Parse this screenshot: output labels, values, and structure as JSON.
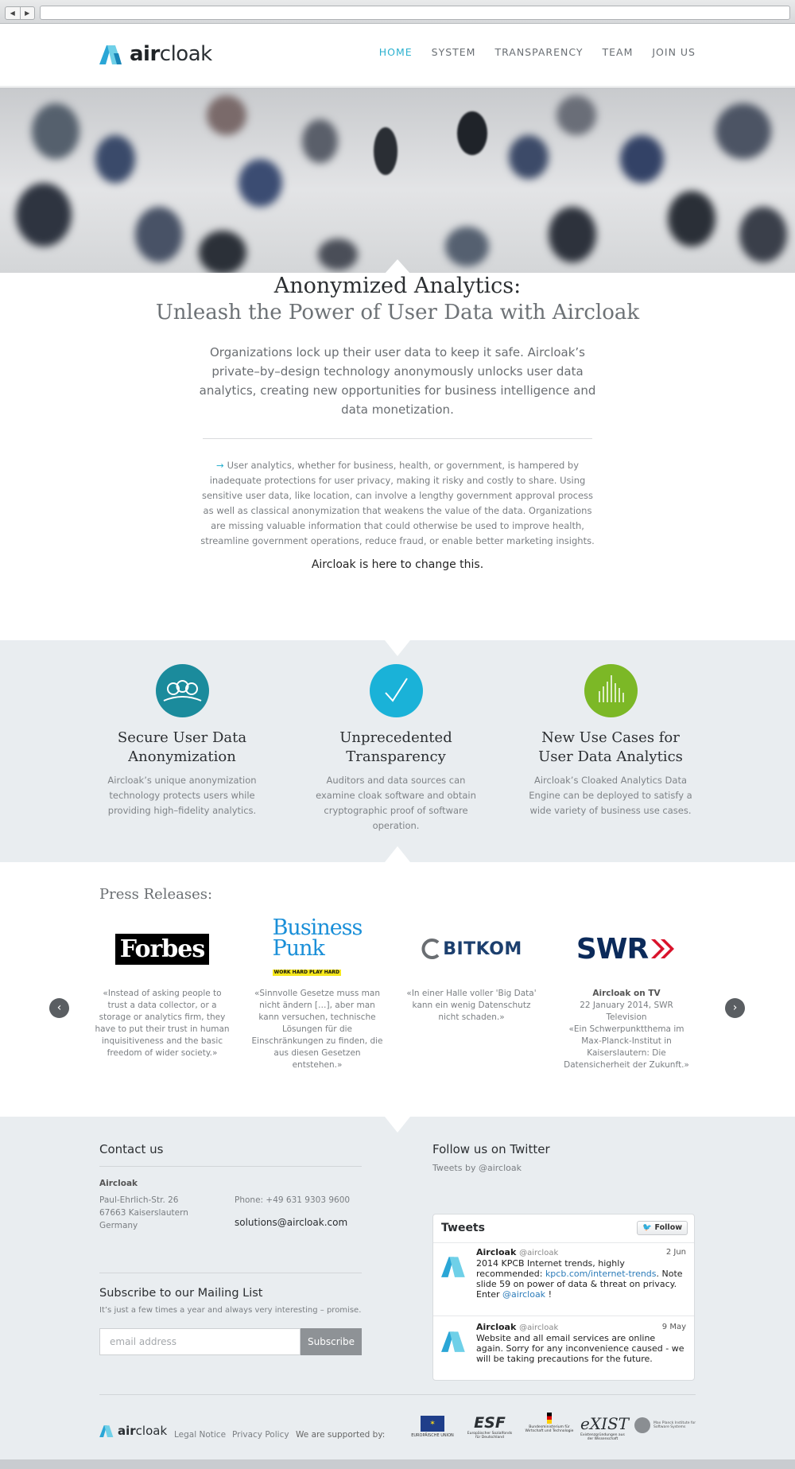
{
  "browser": {
    "back": "◀",
    "forward": "▶",
    "url": ""
  },
  "brand": {
    "name_a": "air",
    "name_b": "cloak",
    "accent": "#2cb1cf"
  },
  "nav": [
    {
      "label": "HOME",
      "active": true
    },
    {
      "label": "SYSTEM",
      "active": false
    },
    {
      "label": "TRANSPARENCY",
      "active": false
    },
    {
      "label": "TEAM",
      "active": false
    },
    {
      "label": "JOIN US",
      "active": false
    }
  ],
  "intro": {
    "title": "Anonymized Analytics:",
    "subtitle": "Unleash the Power of User Data with Aircloak",
    "lead": "Organizations lock up their user data to keep it safe. Aircloak’s private–by–design technology anonymously unlocks user data analytics, creating new opportunities for business intelligence and data monetization.",
    "arrow": "→",
    "body": "User analytics, whether for business, health, or government, is hampered by inadequate protections for user privacy, making it risky and costly to share. Using sensitive user data, like location, can involve a lengthy government approval process as well as classical anonymization that weakens the value of the data. Organizations are missing valuable information that could otherwise be used to improve health, streamline government operations, reduce fraud, or enable better marketing insights.",
    "cta": "Aircloak is here to change this."
  },
  "features": [
    {
      "title": "Secure User Data Anonymization",
      "desc": "Aircloak’s unique anonymization technology protects users while providing high–fidelity analytics.",
      "icon": "users-icon",
      "color": "#1b8b9c"
    },
    {
      "title": "Unprecedented Transparency",
      "desc": "Auditors and data sources can examine cloak software and obtain cryptographic proof of software operation.",
      "icon": "check-icon",
      "color": "#1ab2d8"
    },
    {
      "title": "New Use Cases for User Data Analytics",
      "desc": "Aircloak’s Cloaked Analytics Data Engine can be deployed to satisfy a wide variety of business use cases.",
      "icon": "bars-icon",
      "color": "#7cb826"
    }
  ],
  "press": {
    "title": "Press Releases:",
    "prev": "‹",
    "next": "›",
    "items": [
      {
        "logo": "Forbes",
        "quote": "«Instead of asking people to trust a data collector, or a storage or analytics firm, they have to put their trust in human inquisitiveness and the basic freedom of wider society.»"
      },
      {
        "logo_a": "Business",
        "logo_b": "Punk",
        "logo_c": "WORK HARD PLAY HARD",
        "quote": "«Sinnvolle Gesetze muss man nicht ändern […], aber man kann versuchen, technische Lösungen für die Einschränkungen zu finden, die aus diesen Gesetzen entstehen.»"
      },
      {
        "logo": "BITKOM",
        "quote": "«In einer Halle voller 'Big Data' kann ein wenig Datenschutz nicht schaden.»"
      },
      {
        "logo": "SWR",
        "head": "Aircloak on TV",
        "sub": "22 January 2014, SWR Television",
        "quote": "«Ein Schwerpunktthema im Max-Planck-Institut in Kaiserslautern: Die Datensicherheit der Zukunft.»"
      }
    ]
  },
  "contact": {
    "title": "Contact us",
    "company": "Aircloak",
    "street": "Paul-Ehrlich-Str. 26",
    "city": "67663 Kaiserslautern",
    "country": "Germany",
    "phone": "Phone: +49 631 9303 9600",
    "email": "solutions@aircloak.com"
  },
  "mailing": {
    "title": "Subscribe to our Mailing List",
    "desc": "It’s just a few times a year and always very interesting – promise.",
    "placeholder": "email address",
    "button": "Subscribe"
  },
  "twitter": {
    "title": "Follow us on Twitter",
    "by": "Tweets by @aircloak",
    "widget_title": "Tweets",
    "follow": "Follow",
    "tweets": [
      {
        "name": "Aircloak",
        "handle": "@aircloak",
        "date": "2 Jun",
        "line1": "2014 KPCB Internet trends, highly recommended:",
        "link": "kpcb.com/internet-trends",
        "line2": "Note slide 59 on power of data & threat on privacy. Enter",
        "mention": "@aircloak",
        "end": "!"
      },
      {
        "name": "Aircloak",
        "handle": "@aircloak",
        "date": "9 May",
        "text": "Website and all email services are online again. Sorry for any inconvenience caused - we will be taking precautions for the future."
      }
    ]
  },
  "bottom": {
    "legal": "Legal Notice",
    "privacy": "Privacy Policy",
    "supported": "We are supported by:",
    "sponsors": [
      {
        "name": "EUROPÄISCHE UNION"
      },
      {
        "name": "ESF",
        "sub": "Europäischer Sozialfonds für Deutschland"
      },
      {
        "name": "Bundesministerium für Wirtschaft und Technologie"
      },
      {
        "name": "eXIST",
        "sub": "Existenzgründungen aus der Wissenschaft"
      },
      {
        "name": "Max Planck Institute for Software Systems"
      }
    ]
  }
}
